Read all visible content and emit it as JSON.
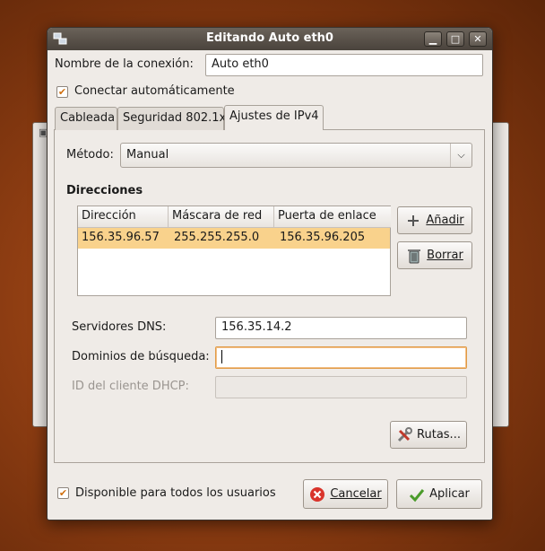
{
  "window": {
    "title": "Editando Auto eth0"
  },
  "connection_name": {
    "label": "Nombre de la conexión:",
    "value": "Auto eth0"
  },
  "auto_connect": {
    "label": "Conectar automáticamente",
    "checked": true
  },
  "tabs": [
    {
      "label": "Cableada"
    },
    {
      "label": "Seguridad 802.1x"
    },
    {
      "label": "Ajustes de IPv4"
    }
  ],
  "method": {
    "label": "Método:",
    "value": "Manual"
  },
  "addresses": {
    "heading": "Direcciones",
    "columns": [
      "Dirección",
      "Máscara de red",
      "Puerta de enlace"
    ],
    "rows": [
      [
        "156.35.96.57",
        "255.255.255.0",
        "156.35.96.205"
      ]
    ],
    "add_label": "Añadir",
    "delete_label": "Borrar"
  },
  "dns": {
    "label": "Servidores DNS:",
    "value": "156.35.14.2"
  },
  "search_domains": {
    "label": "Dominios de búsqueda:",
    "value": ""
  },
  "dhcp_client_id": {
    "label": "ID del cliente DHCP:",
    "value": ""
  },
  "routes_label": "Rutas...",
  "all_users": {
    "label": "Disponible para todos los usuarios",
    "checked": true
  },
  "cancel_label": "Cancelar",
  "apply_label": "Aplicar",
  "colors": {
    "accent": "#e09a45",
    "selection": "#f9d28c",
    "titlebar": "#4a433c"
  }
}
